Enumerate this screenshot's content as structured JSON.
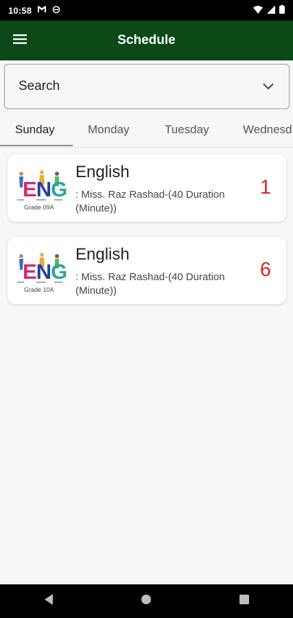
{
  "status_bar": {
    "time": "10:58",
    "icons": [
      "gmail-icon",
      "sync-icon",
      "wifi-icon",
      "signal-icon",
      "battery-icon"
    ]
  },
  "app_bar": {
    "title": "Schedule"
  },
  "search": {
    "label": "Search"
  },
  "tabs": [
    {
      "label": "Sunday",
      "active": true
    },
    {
      "label": "Monday",
      "active": false
    },
    {
      "label": "Tuesday",
      "active": false
    },
    {
      "label": "Wednesd",
      "active": false
    }
  ],
  "lessons": [
    {
      "grade": "Grade 09A",
      "subject": "English",
      "teacher": ": Miss. Raz Rashad-(40 Duration (Minute))",
      "period": "1"
    },
    {
      "grade": "Grade 10A",
      "subject": "English",
      "teacher": ": Miss. Raz Rashad-(40 Duration (Minute))",
      "period": "6"
    }
  ],
  "thumb_text": {
    "e": "E",
    "n": "N",
    "g": "G"
  },
  "colors": {
    "app_bar": "#0b4a16",
    "period": "#e02020"
  }
}
